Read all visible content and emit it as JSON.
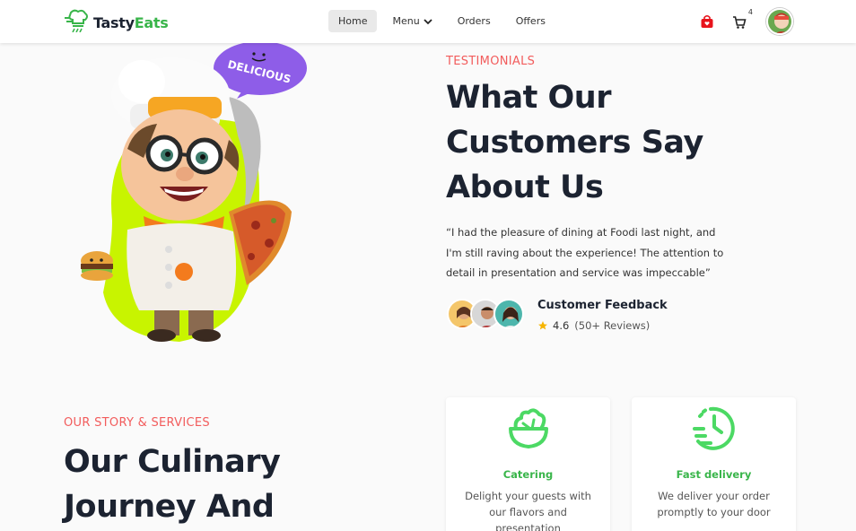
{
  "brand": {
    "name_part1": "Tasty",
    "name_part2": "Eats",
    "accent": "#39b54a"
  },
  "nav": {
    "items": [
      {
        "label": "Home",
        "active": true
      },
      {
        "label": "Menu",
        "has_dropdown": true
      },
      {
        "label": "Orders"
      },
      {
        "label": "Offers"
      }
    ],
    "cart_count": "4",
    "icons": [
      "shopping-bag-icon",
      "cart-icon",
      "user-avatar"
    ]
  },
  "hero": {
    "bubble_text": "DELICIOUS"
  },
  "testimonials": {
    "eyebrow": "TESTIMONIALS",
    "title": "What Our Customers Say About Us",
    "quote": "“I had the pleasure of dining at Foodi last night, and I'm still raving about the experience! The attention to detail in presentation and service was impeccable”",
    "feedback_title": "Customer Feedback",
    "rating": "4.6",
    "reviews": "(50+ Reviews)"
  },
  "story": {
    "eyebrow": "OUR STORY & SERVICES",
    "title": "Our Culinary Journey And"
  },
  "services": [
    {
      "title": "Catering",
      "description": "Delight your guests with our flavors and presentation",
      "icon": "salad-bowl-icon"
    },
    {
      "title": "Fast delivery",
      "description": "We deliver your order promptly to your door",
      "icon": "clock-icon"
    }
  ],
  "colors": {
    "eyebrow": "#f25c5c",
    "heading": "#1c2331",
    "lime": "#c8f400",
    "bubble": "#8e5de8",
    "star": "#f6b400"
  }
}
